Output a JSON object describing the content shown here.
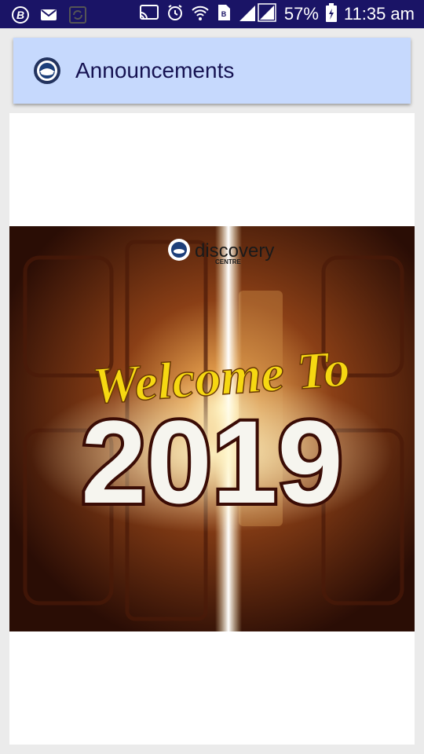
{
  "status_bar": {
    "battery_percent": "57%",
    "time": "11:35 am",
    "icons_left": [
      "b-app-icon",
      "mail-icon",
      "sync-icon"
    ],
    "icons_right": [
      "cast-icon",
      "alarm-icon",
      "wifi-icon",
      "document-icon",
      "signal-icon",
      "battery-icon"
    ]
  },
  "app_bar": {
    "title": "Announcements",
    "logo_icon": "church-logo-icon"
  },
  "announcement": {
    "brand_name": "discovery",
    "brand_sub": "CENTRE",
    "headline": "Welcome To",
    "year": "2019"
  },
  "colors": {
    "status_bar": "#1a1466",
    "app_bar": "#c6d9fd",
    "title_text": "#161352",
    "background": "#ebebeb",
    "headline_yellow": "#f6d812"
  }
}
